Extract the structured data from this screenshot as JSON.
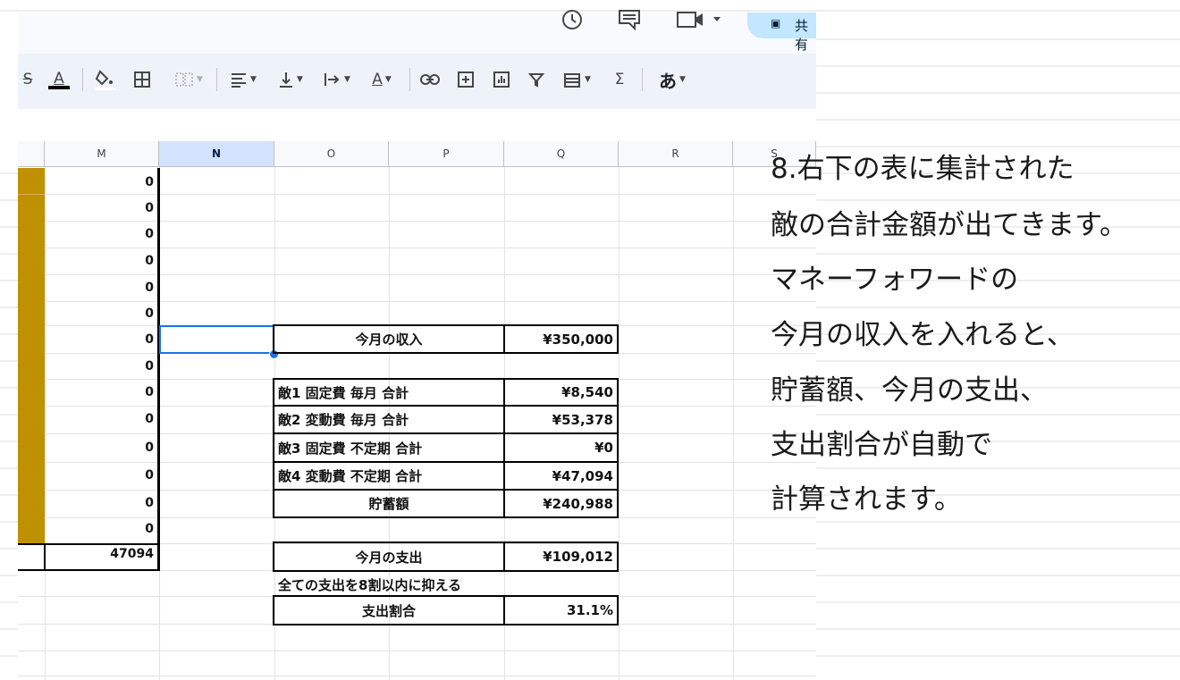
{
  "toolbar": {
    "strike_icon": "strikethrough-icon",
    "text_color_glyph": "A",
    "fill_icon": "fill-color-icon",
    "borders_icon": "borders-icon",
    "merge_icon": "merge-cells-icon",
    "align_icon": "horizontal-align-icon",
    "valign_icon": "vertical-align-icon",
    "wrap_icon": "text-wrap-icon",
    "rotate_glyph": "A",
    "link_icon": "link-icon",
    "comment_icon": "comment-icon",
    "chart_icon": "chart-icon",
    "filter_icon": "filter-icon",
    "views_icon": "filter-views-icon",
    "function_glyph": "Σ",
    "input_glyph": "あ"
  },
  "topbar": {
    "history_icon": "history-icon",
    "comments_icon": "comments-icon",
    "meet_icon": "meet-icon",
    "share_label": "共有"
  },
  "columns": [
    "M",
    "N",
    "O",
    "P",
    "Q",
    "R",
    "S"
  ],
  "selected_column": "N",
  "m_values": [
    "0",
    "0",
    "0",
    "0",
    "0",
    "0",
    "0",
    "0",
    "0",
    "0",
    "0",
    "0",
    "0",
    "0"
  ],
  "m_total": "47094",
  "summary": {
    "income_label": "今月の収入",
    "income_value": "¥350,000",
    "rows": [
      {
        "label": "敵1 固定費 毎月 合計",
        "value": "¥8,540"
      },
      {
        "label": "敵2 変動費 毎月 合計",
        "value": "¥53,378"
      },
      {
        "label": "敵3 固定費 不定期 合計",
        "value": "¥0"
      },
      {
        "label": "敵4 変動費 不定期 合計",
        "value": "¥47,094"
      }
    ],
    "savings_label": "貯蓄額",
    "savings_value": "¥240,988",
    "expense_label": "今月の支出",
    "expense_value": "¥109,012",
    "goal_note": "全ての支出を8割以内に抑える",
    "ratio_label": "支出割合",
    "ratio_value": "31.1%"
  },
  "explanation": [
    "8.右下の表に集計された",
    "敵の合計金額が出てきます。",
    "マネーフォワードの",
    "今月の収入を入れると、",
    "貯蓄額、今月の支出、",
    "支出割合が自動で",
    "計算されます。"
  ],
  "colors": {
    "gold": "#bf9000",
    "selection": "#1a73e8",
    "toolbar_bg": "#eef3fa",
    "share_bg": "#c2e7ff"
  }
}
